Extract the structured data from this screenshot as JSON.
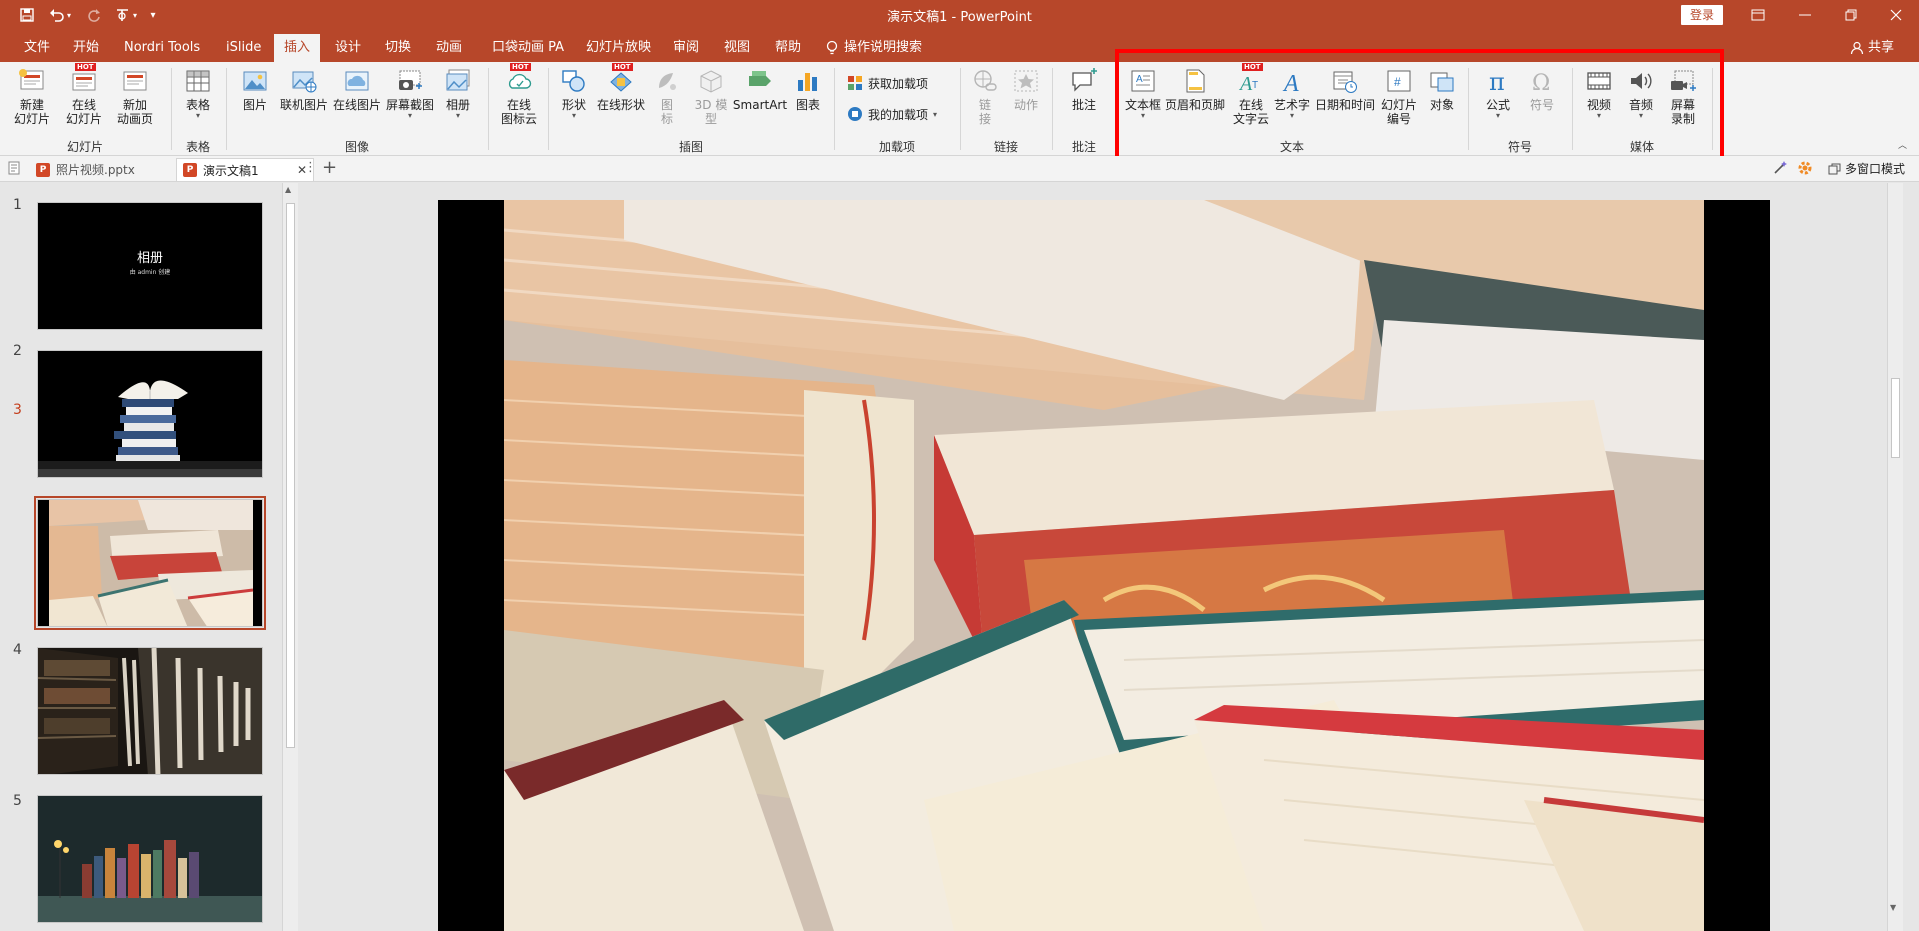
{
  "titlebar": {
    "doc_title": "演示文稿1 - PowerPoint",
    "login_label": "登录",
    "quick_access": [
      "save-icon",
      "undo-icon",
      "redo-icon",
      "touch-mode-icon",
      "customize-icon"
    ]
  },
  "tabs": [
    "文件",
    "开始",
    "Nordri Tools",
    "iSlide",
    "插入",
    "设计",
    "切换",
    "动画",
    "口袋动画 PA",
    "幻灯片放映",
    "审阅",
    "视图",
    "帮助"
  ],
  "active_tab": "插入",
  "tell_me": "操作说明搜索",
  "share_label": "共享",
  "ribbon": {
    "slides": {
      "group": "幻灯片",
      "new_slide": [
        "新建",
        "幻灯片"
      ],
      "online_slide": [
        "在线",
        "幻灯片"
      ],
      "new_anim": [
        "新加",
        "动画页"
      ]
    },
    "tables": {
      "group": "表格",
      "table": "表格"
    },
    "images": {
      "group": "图像",
      "picture": "图片",
      "online_picture": "联机图片",
      "online_pic2": "在线图片",
      "screenshot": "屏幕截图",
      "album": "相册"
    },
    "iconcloud": {
      "label": [
        "在线",
        "图标云"
      ]
    },
    "illustrations": {
      "group": "插图",
      "shapes": "形状",
      "online_shapes": "在线形状",
      "icons": [
        "图",
        "标"
      ],
      "model3d": [
        "3D 模",
        "型"
      ],
      "smartart": "SmartArt",
      "chart": "图表"
    },
    "addins": {
      "group": "加载项",
      "get": "获取加载项",
      "mine": "我的加载项"
    },
    "links": {
      "group": "链接",
      "link": [
        "链",
        "接"
      ],
      "action": "动作"
    },
    "comments": {
      "group": "批注",
      "comment": "批注"
    },
    "text": {
      "group": "文本",
      "textbox": "文本框",
      "header_footer": "页眉和页脚",
      "online_font": [
        "在线",
        "文字云"
      ],
      "wordart": "艺术字",
      "datetime": "日期和时间",
      "slide_number": [
        "幻灯片",
        "编号"
      ],
      "object": "对象"
    },
    "symbols": {
      "group": "符号",
      "equation": "公式",
      "symbol": "符号"
    },
    "media": {
      "group": "媒体",
      "video": "视频",
      "audio": "音频",
      "screen_rec": [
        "屏幕",
        "录制"
      ]
    },
    "hot_badge": "HOT"
  },
  "doc_tabs": [
    {
      "name": "照片视频.pptx",
      "active": false
    },
    {
      "name": "演示文稿1",
      "active": true
    }
  ],
  "multi_window": "多窗口模式",
  "slides": [
    {
      "number": "1",
      "title": "相册",
      "subtitle": "由 admin 创建"
    },
    {
      "number": "2"
    },
    {
      "number": "3"
    },
    {
      "number": "4"
    },
    {
      "number": "5"
    }
  ],
  "current_slide": "3",
  "colors": {
    "accent": "#b7472a",
    "ribbon_bg": "#f3f3f3",
    "highlight": "#ff0000"
  }
}
